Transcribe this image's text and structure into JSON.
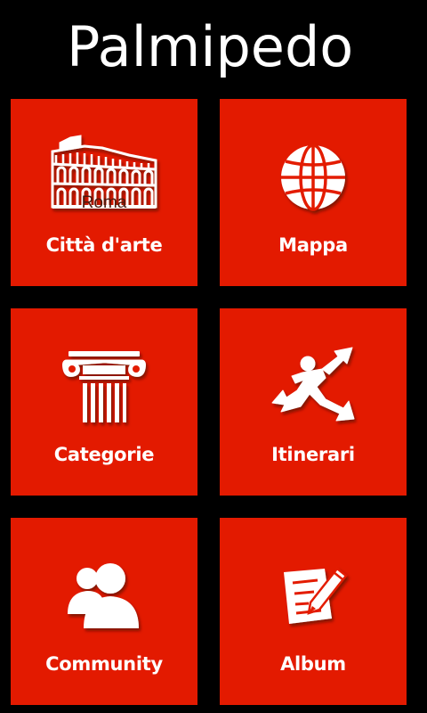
{
  "app": {
    "title": "Palmipedo"
  },
  "tiles": [
    {
      "label": "Città d'arte",
      "icon": "colosseum-icon",
      "caption": "Roma"
    },
    {
      "label": "Mappa",
      "icon": "globe-icon"
    },
    {
      "label": "Categorie",
      "icon": "column-icon"
    },
    {
      "label": "Itinerari",
      "icon": "running-arrows-icon"
    },
    {
      "label": "Community",
      "icon": "users-icon"
    },
    {
      "label": "Album",
      "icon": "notepad-pencil-icon"
    }
  ],
  "colors": {
    "background": "#000000",
    "tile": "#e31a00",
    "text": "#ffffff"
  }
}
